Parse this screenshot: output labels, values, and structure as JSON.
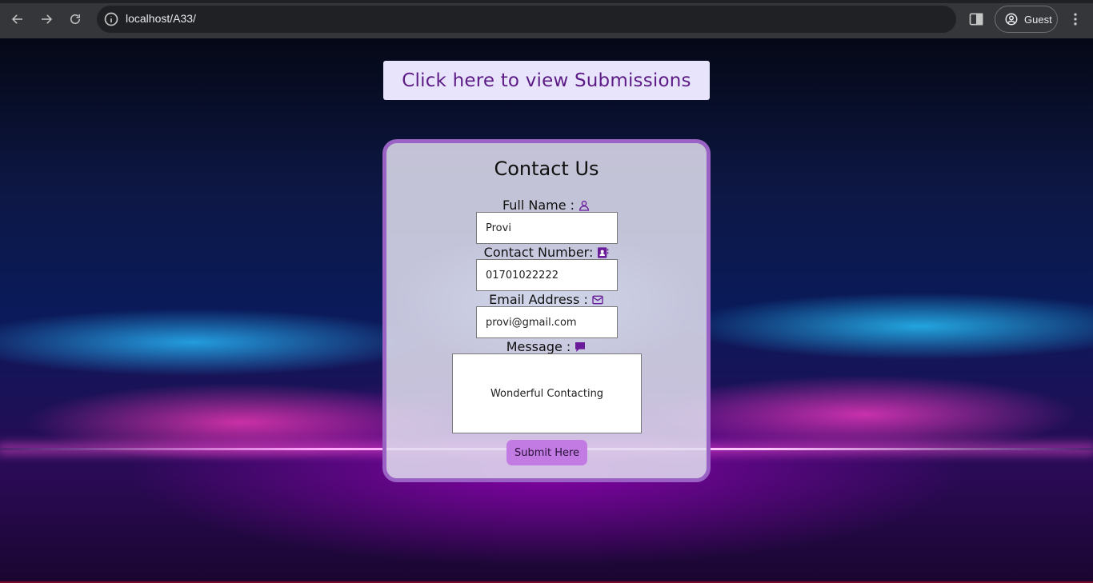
{
  "browser": {
    "url": "localhost/A33/",
    "profile_label": "Guest",
    "back_icon": "arrow-left-icon",
    "forward_icon": "arrow-right-icon",
    "reload_icon": "reload-icon"
  },
  "page": {
    "view_submissions_label": "Click here to view Submissions",
    "form": {
      "title": "Contact Us",
      "full_name_label": "Full Name :",
      "full_name_value": "Provi",
      "contact_label": "Contact Number:",
      "contact_value": "01701022222",
      "email_label": "Email Address :",
      "email_value": "provi@gmail.com",
      "message_label": "Message :",
      "message_value": "Wonderful Contacting",
      "submit_label": "Submit Here"
    },
    "colors": {
      "accent": "#9a62c4",
      "button_bg": "#e7e4fb",
      "button_text": "#5d1b86",
      "submit_bg": "#c27be3",
      "icon": "#6a1b9a"
    }
  }
}
